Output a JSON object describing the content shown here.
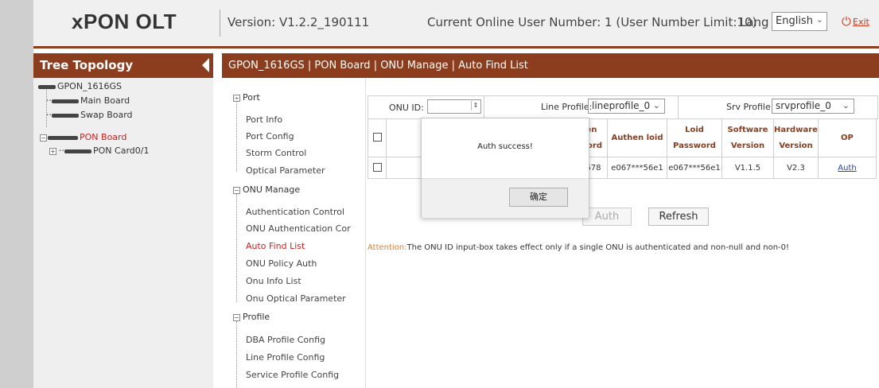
{
  "header": {
    "logo": "xPON OLT",
    "version": "Version: V1.2.2_190111",
    "online": "Current Online User Number: 1 (User Number Limit:10)",
    "lang_label": "Lang",
    "lang_value": "English",
    "exit_label": "Exit"
  },
  "tree": {
    "title": "Tree Topology",
    "nodes": [
      "GPON_1616GS",
      "Main Board",
      "Swap Board",
      "PON Board",
      "PON Card0/1"
    ]
  },
  "breadcrumb": "GPON_1616GS | PON Board | ONU Manage | Auto Find List",
  "menu": {
    "port": {
      "label": "Port",
      "items": [
        "Port Info",
        "Port Config",
        "Storm Control",
        "Optical Parameter"
      ]
    },
    "onu_manage": {
      "label": "ONU Manage",
      "items": [
        "Authentication Control",
        "ONU Authentication Cor",
        "Auto Find List",
        "ONU Policy Auth",
        "Onu Info List",
        "Onu Optical Parameter"
      ]
    },
    "profile": {
      "label": "Profile",
      "items": [
        "DBA Profile Config",
        "Line Profile Config",
        "Service Profile Config"
      ]
    }
  },
  "filter": {
    "onu_id_label": "ONU ID:",
    "onu_id_value": "",
    "line_profile_label": "Line Profile:",
    "line_profile_value": "lineprofile_0",
    "srv_profile_label": "Srv Profile:",
    "srv_profile_value": "srvprofile_0"
  },
  "table": {
    "headers": {
      "authen_password": [
        "Authen",
        "password"
      ],
      "authen_loid": "Authen loid",
      "loid_password": [
        "Loid",
        "Password"
      ],
      "software_version": [
        "Software",
        "Version"
      ],
      "hardware_version": [
        "Hardware",
        "Version"
      ],
      "op": "OP"
    },
    "rows": [
      {
        "authen_password": "12345678",
        "authen_loid": "e067***56e1",
        "loid_password": "e067***56e1",
        "software_version": "V1.1.5",
        "hardware_version": "V2.3",
        "op": "Auth"
      }
    ]
  },
  "buttons": {
    "auth": "Auth",
    "refresh": "Refresh"
  },
  "attention": {
    "label": "Attention:",
    "text": "The ONU ID input-box takes effect only if a single ONU is authenticated and non-null and non-0!"
  },
  "dialog": {
    "message": "Auth success!",
    "ok": "确定"
  },
  "colors": {
    "brand_bar": "#8b3d1e",
    "active_red": "#d01f1f",
    "link_blue": "#1a43c7",
    "exit_red": "#e03a1e"
  }
}
